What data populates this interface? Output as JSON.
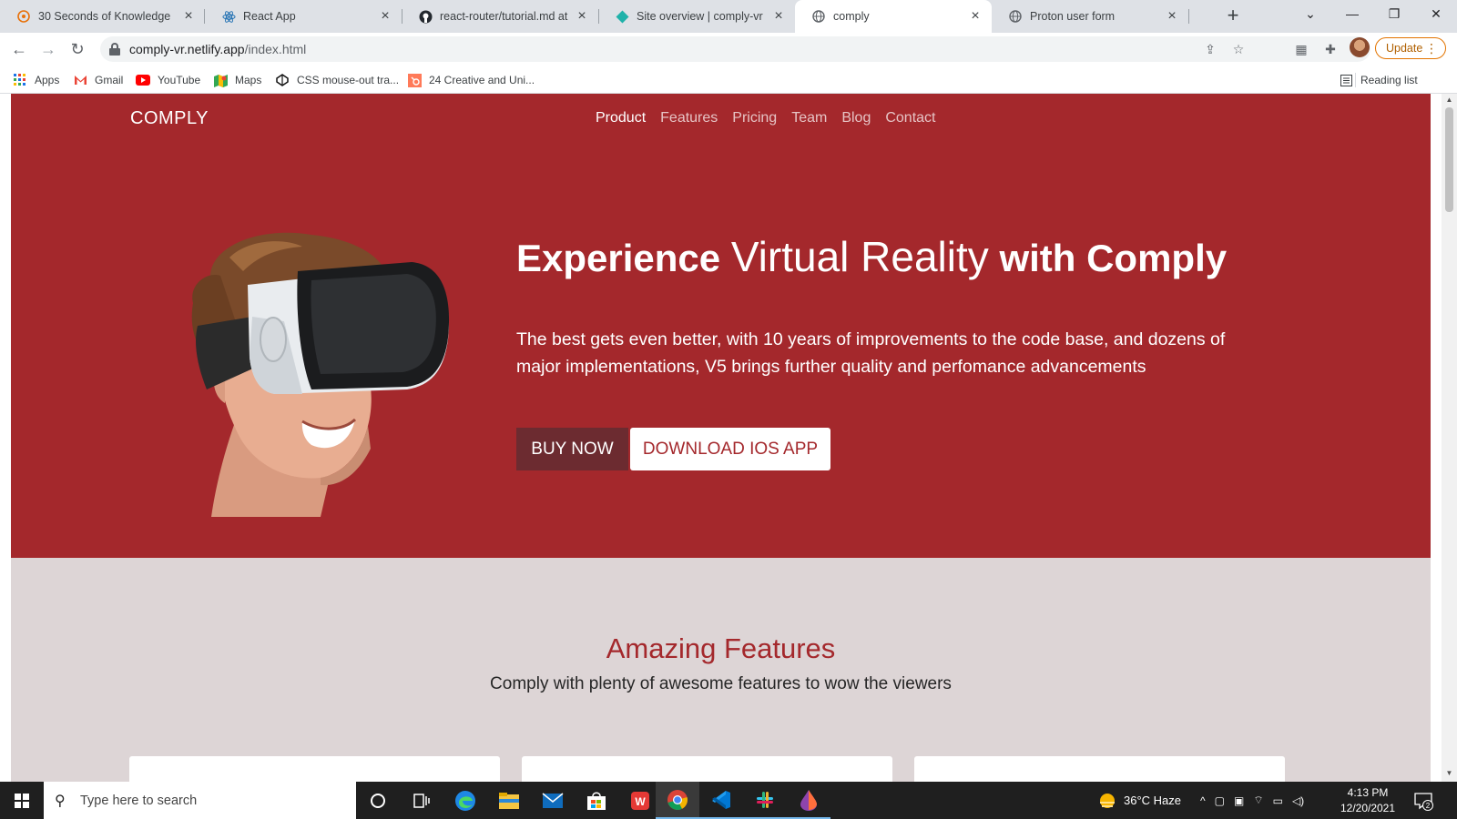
{
  "browser": {
    "tabs": [
      {
        "title": "30 Seconds of Knowledge",
        "icon": "knowledge-favicon"
      },
      {
        "title": "React App",
        "icon": "react-favicon"
      },
      {
        "title": "react-router/tutorial.md at m",
        "icon": "github-favicon"
      },
      {
        "title": "Site overview | comply-vr",
        "icon": "netlify-favicon"
      },
      {
        "title": "comply",
        "icon": "globe-favicon",
        "active": true
      },
      {
        "title": "Proton user form",
        "icon": "globe-favicon"
      }
    ],
    "new_tab": "+",
    "url_host": "comply-vr.netlify.app",
    "url_path": "/index.html",
    "update_label": "Update",
    "bookmarks": [
      {
        "label": "Apps",
        "icon": "apps-grid-icon"
      },
      {
        "label": "Gmail",
        "icon": "gmail-icon"
      },
      {
        "label": "YouTube",
        "icon": "youtube-icon"
      },
      {
        "label": "Maps",
        "icon": "maps-icon"
      },
      {
        "label": "CSS mouse-out tra...",
        "icon": "codepen-icon"
      },
      {
        "label": "24 Creative and Uni...",
        "icon": "hubspot-icon"
      }
    ],
    "reading_list": "Reading list"
  },
  "page": {
    "brand": "COMPLY",
    "nav": [
      "Product",
      "Features",
      "Pricing",
      "Team",
      "Blog",
      "Contact"
    ],
    "active_nav": "Product",
    "headline": {
      "part1": "Experience",
      "part2": "Virtual Reality",
      "part3": "with Comply"
    },
    "subtext": "The best gets even better, with 10 years of improvements to the code base, and dozens of major implementations, V5 brings further quality and perfomance advancements",
    "buy_label": "BUY NOW",
    "ios_label": "DOWNLOAD IOS APP",
    "features_title": "Amazing Features",
    "features_subtitle": "Comply with plenty of awesome features to wow the viewers",
    "colors": {
      "primary": "#a4282c",
      "dark_button": "#6c2b30",
      "section_bg": "#ddd5d6"
    }
  },
  "taskbar": {
    "search_placeholder": "Type here to search",
    "weather": "36°C  Haze",
    "time": "4:13 PM",
    "date": "12/20/2021",
    "notifications": "2"
  }
}
